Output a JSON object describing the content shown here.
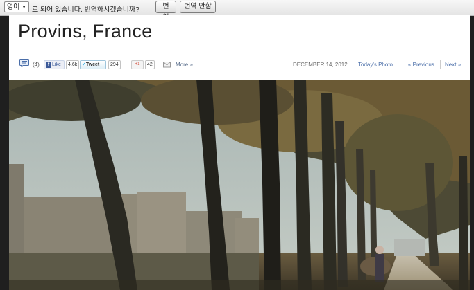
{
  "translate_bar": {
    "language": "영어",
    "message": "로 되어 있습니다. 번역하시겠습니까?",
    "translate_label": "번역",
    "no_translate_label": "번역 안함"
  },
  "article": {
    "title": "Provins, France",
    "comments_count": "(4)",
    "fb_like_label": "Like",
    "fb_like_count": "4.6k",
    "tweet_label": "Tweet",
    "tweet_count": "294",
    "gplus_label": "+1",
    "gplus_count": "42",
    "more_label": "More »",
    "date": "DECEMBER 14, 2012",
    "category": "Today's Photo",
    "previous_label": "« Previous",
    "next_label": "Next »"
  },
  "icons": [
    "chevron-down-icon",
    "comment-icon",
    "facebook-icon",
    "twitter-icon",
    "google-plus-icon",
    "mail-icon"
  ]
}
